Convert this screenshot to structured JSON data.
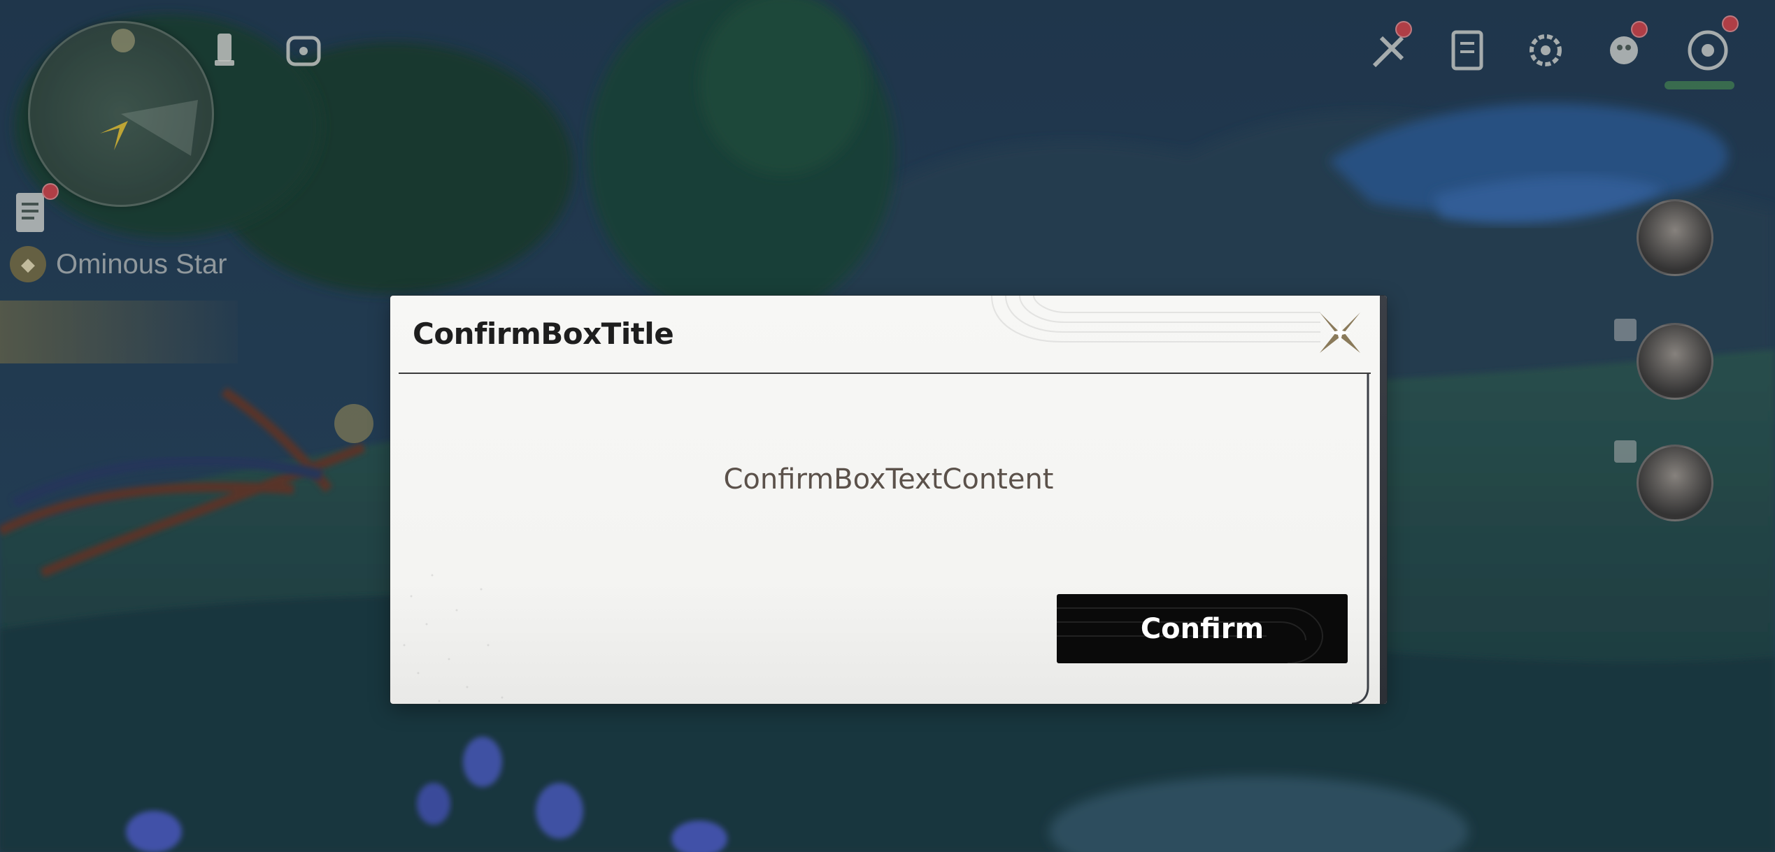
{
  "hud": {
    "quest_name": "Ominous Star",
    "icons": [
      "minimap",
      "character-icon",
      "gamepad-icon",
      "event-icon",
      "quest-book-icon",
      "settings-icon",
      "wish-icon",
      "compass-icon",
      "document-icon"
    ]
  },
  "dialog": {
    "title": "ConfirmBoxTitle",
    "content": "ConfirmBoxTextContent",
    "confirm_label": "Confirm"
  },
  "colors": {
    "dialog_bg": "#f5f5f3",
    "button_bg": "#0a0a0a",
    "button_text": "#ffffff",
    "title_text": "#1e1e1e",
    "content_text": "#5b514a",
    "close_icon": "#8a7a5a"
  }
}
